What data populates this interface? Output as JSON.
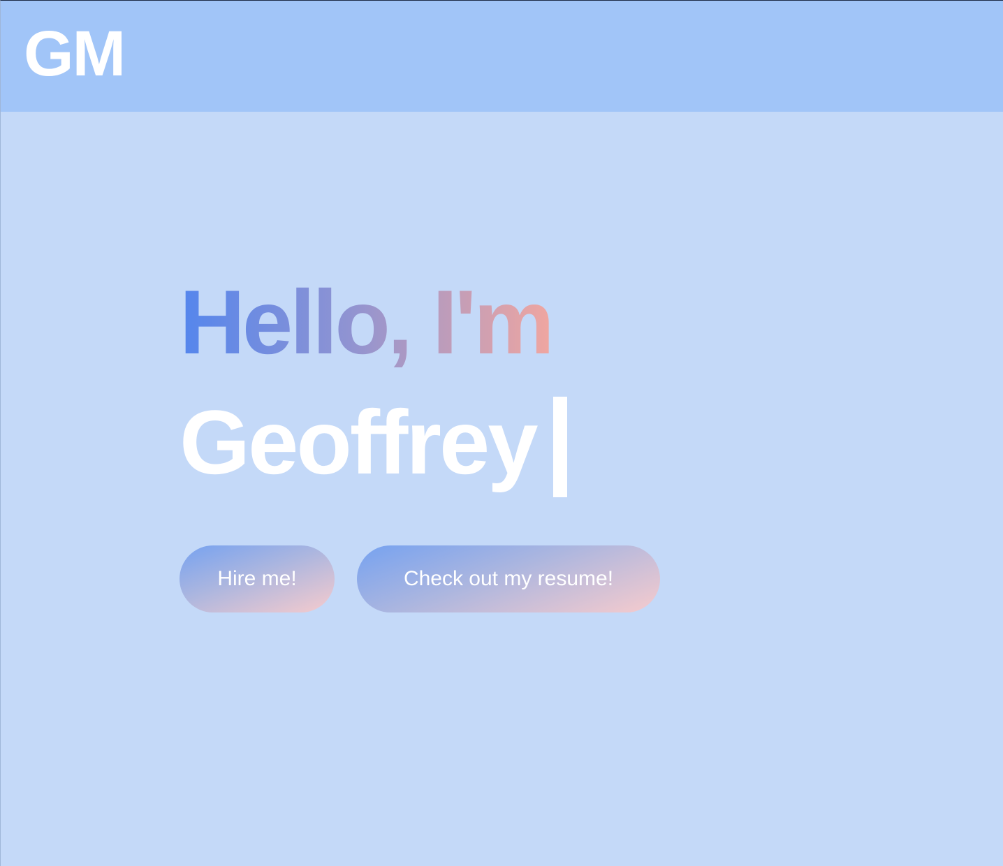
{
  "navbar": {
    "logo": "GM"
  },
  "hero": {
    "greeting": "Hello, I'm",
    "name": "Geoffrey"
  },
  "buttons": {
    "hire": "Hire me!",
    "resume": "Check out my resume!"
  },
  "colors": {
    "background": "#c4d9f8",
    "navbar": "#a1c5f8",
    "gradient_start": "#5486ed",
    "gradient_end": "#f0a6a0",
    "text": "#ffffff"
  }
}
